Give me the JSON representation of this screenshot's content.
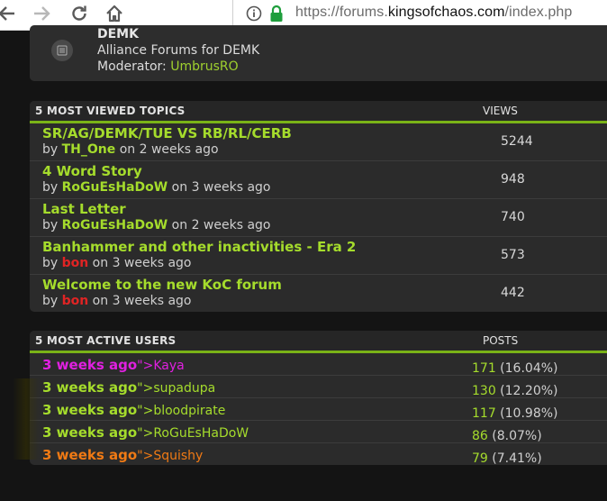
{
  "browser": {
    "icons": [
      "back-arrow-icon",
      "forward-arrow-icon",
      "reload-icon",
      "home-icon",
      "info-icon",
      "lock-icon"
    ],
    "url_scheme": "https://forums.",
    "url_host": "kingsofchaos.com",
    "url_path": "/index.php"
  },
  "forum": {
    "title": "DEMK",
    "description": "Alliance Forums for DEMK",
    "moderator_label": "Moderator: ",
    "moderator_name": "UmbrusRO"
  },
  "most_viewed": {
    "heading": "5 MOST VIEWED TOPICS",
    "views_heading": "VIEWS",
    "topics": [
      {
        "title": "SR/AG/DEMK/TUE VS RB/RL/CERB",
        "by": "by ",
        "author": "TH_One",
        "when": " on 2 weeks ago",
        "views": "5244",
        "author_color": "#a5dc2c"
      },
      {
        "title": "4 Word Story",
        "by": "by ",
        "author": "RoGuEsHaDoW",
        "when": " on 3 weeks ago",
        "views": "948",
        "author_color": "#a5dc2c"
      },
      {
        "title": "Last Letter",
        "by": "by ",
        "author": "RoGuEsHaDoW",
        "when": " on 2 weeks ago",
        "views": "740",
        "author_color": "#a5dc2c"
      },
      {
        "title": "Banhammer and other inactivities - Era 2",
        "by": "by ",
        "author": "bon",
        "when": " on 3 weeks ago",
        "views": "573",
        "author_color": "#e02424"
      },
      {
        "title": "Welcome to the new KoC forum",
        "by": "by ",
        "author": "bon",
        "when": " on 3 weeks ago",
        "views": "442",
        "author_color": "#e02424"
      }
    ]
  },
  "most_active": {
    "heading": "5 MOST ACTIVE USERS",
    "posts_heading": "POSTS",
    "users": [
      {
        "when": "3 weeks ago",
        "name": "\">Kaya",
        "posts": "171",
        "pct": " (16.04%)",
        "color": "#e020e0"
      },
      {
        "when": "3 weeks ago",
        "name": "\">supadupa",
        "posts": "130",
        "pct": " (12.20%)",
        "color": "#a5dc2c"
      },
      {
        "when": "3 weeks ago",
        "name": "\">bloodpirate",
        "posts": "117",
        "pct": " (10.98%)",
        "color": "#a5dc2c"
      },
      {
        "when": "3 weeks ago",
        "name": "\">RoGuEsHaDoW",
        "posts": "86",
        "pct": " (8.07%)",
        "color": "#a5dc2c"
      },
      {
        "when": "3 weeks ago",
        "name": "\">Squishy",
        "posts": "79",
        "pct": " (7.41%)",
        "color": "#f07a14"
      }
    ]
  }
}
